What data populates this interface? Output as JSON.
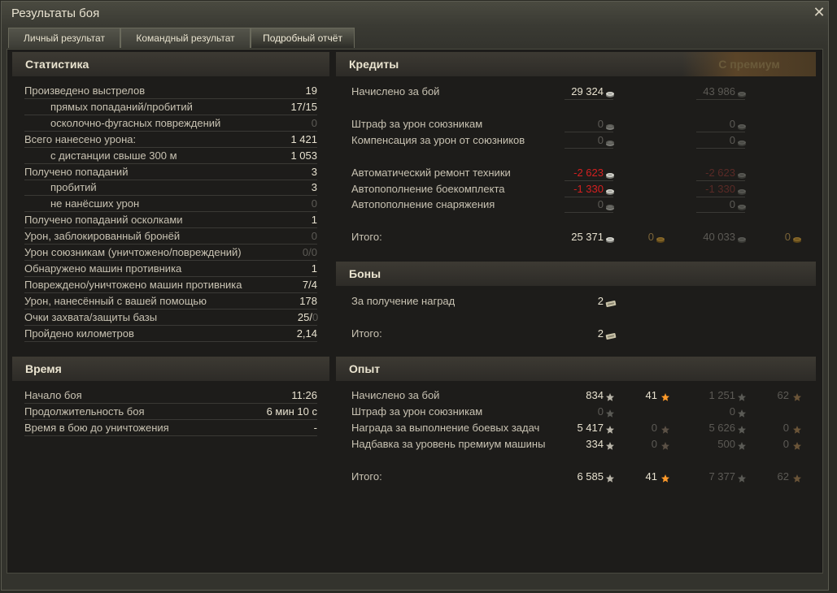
{
  "window": {
    "title": "Результаты боя"
  },
  "tabs": [
    {
      "label": "Личный результат"
    },
    {
      "label": "Командный результат"
    },
    {
      "label": "Подробный отчёт"
    }
  ],
  "icons": {
    "close": "close-icon",
    "credit": "silver-coin-icon",
    "gold": "gold-coin-icon",
    "bond": "bond-icon",
    "star": "experience-star-icon",
    "star_premium": "orange-star-icon"
  },
  "colors": {
    "negative": "#d42020",
    "gold": "#c89a3a",
    "star": "#ff9a2a"
  },
  "stats": {
    "header": "Статистика",
    "rows": [
      {
        "label": "Произведено выстрелов",
        "value": "19"
      },
      {
        "label": "прямых попаданий/пробитий",
        "value": "17/15"
      },
      {
        "label": "осколочно-фугасных повреждений",
        "value": "0"
      },
      {
        "label": "Всего нанесено урона:",
        "value": "1 421"
      },
      {
        "label": "с дистанции свыше 300 м",
        "value": "1 053"
      },
      {
        "label": "Получено попаданий",
        "value": "3"
      },
      {
        "label": "пробитий",
        "value": "3"
      },
      {
        "label": "не нанёсших урон",
        "value": "0"
      },
      {
        "label": "Получено попаданий осколками",
        "value": "1"
      },
      {
        "label": "Урон, заблокированный бронёй",
        "value": "0"
      },
      {
        "label": "Урон союзникам (уничтожено/повреждений)",
        "value": "0/0"
      },
      {
        "label": "Обнаружено машин противника",
        "value": "1"
      },
      {
        "label": "Повреждено/уничтожено машин противника",
        "value": "7/4"
      },
      {
        "label": "Урон, нанесённый с вашей помощью",
        "value": "178"
      },
      {
        "label": "Очки захвата/защиты базы",
        "value": "25/",
        "value_dim": "0"
      },
      {
        "label": "Пройдено километров",
        "value": "2,14"
      }
    ]
  },
  "time": {
    "header": "Время",
    "rows": [
      {
        "label": "Начало боя",
        "value": "11:26"
      },
      {
        "label": "Продолжительность боя",
        "value": "6 мин 10 с"
      },
      {
        "label": "Время в бою до уничтожения",
        "value": "-"
      }
    ]
  },
  "credits": {
    "header": "Кредиты",
    "premium_header": "С премиум",
    "rows": [
      {
        "label": "Начислено за бой",
        "value": "29 324",
        "premium": "43 986"
      },
      {
        "label": "Штраф за урон союзникам",
        "value": "0",
        "premium": "0"
      },
      {
        "label": "Компенсация за урон от союзников",
        "value": "0",
        "premium": "0"
      },
      {
        "label": "Автоматический ремонт техники",
        "value": "-2 623",
        "premium": "-2 623"
      },
      {
        "label": "Автопополнение боекомплекта",
        "value": "-1 330",
        "premium": "-1 330"
      },
      {
        "label": "Автопополнение снаряжения",
        "value": "0",
        "premium": "0"
      }
    ],
    "total": {
      "label": "Итого:",
      "value": "25 371",
      "gold": "0",
      "premium": "40 033",
      "premium_gold": "0"
    }
  },
  "bonds": {
    "header": "Боны",
    "rows": [
      {
        "label": "За получение наград",
        "value": "2"
      },
      {
        "label": "Итого:",
        "value": "2"
      }
    ]
  },
  "experience": {
    "header": "Опыт",
    "rows": [
      {
        "label": "Начислено за бой",
        "xp": "834",
        "free": "41",
        "prem_xp": "1 251",
        "prem_free": "62"
      },
      {
        "label": "Штраф за урон союзникам",
        "xp": "0",
        "free": "",
        "prem_xp": "0",
        "prem_free": ""
      },
      {
        "label": "Награда за выполнение боевых задач",
        "xp": "5 417",
        "free": "0",
        "prem_xp": "5 626",
        "prem_free": "0"
      },
      {
        "label": "Надбавка за уровень премиум машины",
        "xp": "334",
        "free": "0",
        "prem_xp": "500",
        "prem_free": "0"
      }
    ],
    "total": {
      "label": "Итого:",
      "xp": "6 585",
      "free": "41",
      "prem_xp": "7 377",
      "prem_free": "62"
    }
  }
}
